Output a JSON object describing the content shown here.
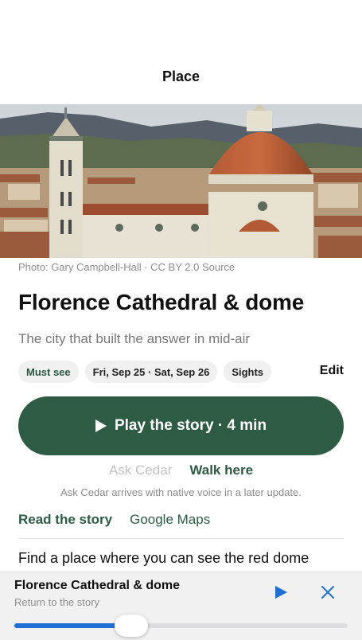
{
  "nav": {
    "title": "Place"
  },
  "hero": {
    "credit": "Photo: Gary Campbell-Hall · CC BY 2.0 Source"
  },
  "place": {
    "title": "Florence Cathedral & dome",
    "subtitle": "The city that built the answer in mid-air"
  },
  "chips": [
    "Must see",
    "Fri, Sep 25 · Sat, Sep 26",
    "Sights"
  ],
  "edit_label": "Edit",
  "play_button": {
    "label": "Play the story · 4 min",
    "icon": "play-icon"
  },
  "actions": {
    "ask": "Ask Cedar",
    "walk": "Walk here"
  },
  "note": "Ask Cedar arrives with native voice in a later update.",
  "links": {
    "read": "Read the story",
    "maps": "Google Maps"
  },
  "prompt": "Find a place where you can see the red dome",
  "mini_player": {
    "title": "Florence Cathedral & dome",
    "subtitle": "Return to the story",
    "progress": 0.35
  },
  "colors": {
    "accent": "#2e5b44",
    "player_blue": "#1f6fd6"
  }
}
